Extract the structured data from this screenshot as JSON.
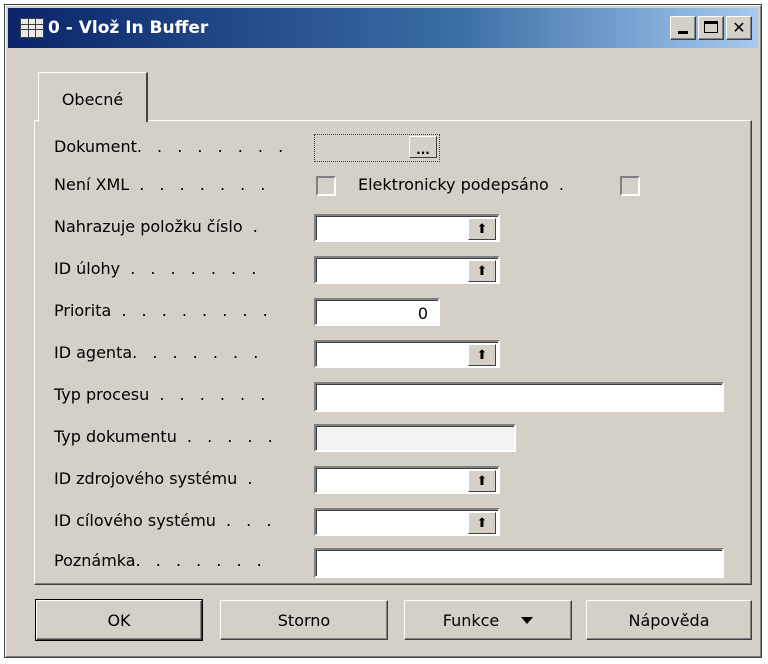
{
  "window": {
    "title": "0 - Vlož In Buffer"
  },
  "tabs": [
    {
      "label": "Obecné"
    }
  ],
  "fields": {
    "dokument": {
      "label": "Dokument",
      "assist": "..."
    },
    "neni_xml": {
      "label": "Není XML",
      "checked": false
    },
    "elektronicky": {
      "label": "Elektronicky podepsáno",
      "checked": false
    },
    "nahrazuje": {
      "label": "Nahrazuje položku číslo",
      "value": ""
    },
    "id_ulohy": {
      "label": "ID úlohy",
      "value": ""
    },
    "priorita": {
      "label": "Priorita",
      "value": "0"
    },
    "id_agenta": {
      "label": "ID agenta",
      "value": ""
    },
    "typ_procesu": {
      "label": "Typ procesu",
      "value": ""
    },
    "typ_dokumentu": {
      "label": "Typ dokumentu",
      "value": ""
    },
    "id_zdroj": {
      "label": "ID zdrojového systému",
      "value": ""
    },
    "id_cil": {
      "label": "ID cílového systému",
      "value": ""
    },
    "poznamka": {
      "label": "Poznámka",
      "value": ""
    }
  },
  "buttons": {
    "ok": "OK",
    "storno": "Storno",
    "funkce": "Funkce",
    "napoveda": "Nápověda"
  },
  "icons": {
    "lookup": "up-arrow-lookup-icon",
    "dropdown": "chevron-down-icon"
  }
}
